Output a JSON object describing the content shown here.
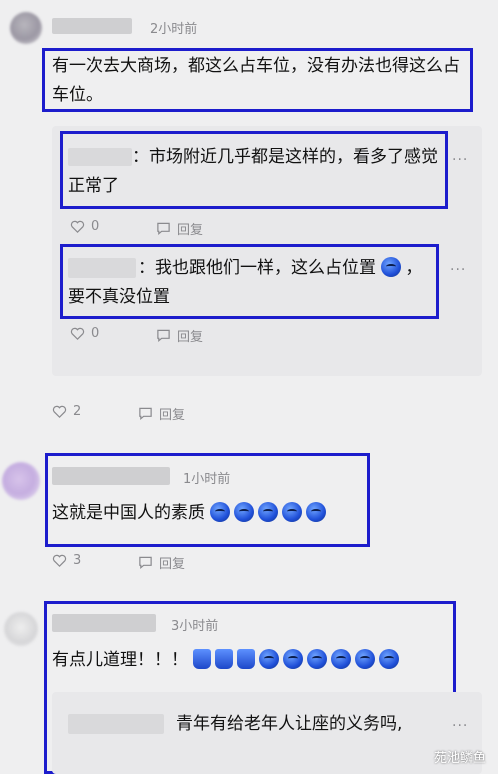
{
  "comments": [
    {
      "time": "2小时前",
      "text": "有一次去大商场，都这么占车位，没有办法也得这么占车位。",
      "replies": [
        {
          "separator": "：",
          "text": "市场附近几乎都是这样的，看多了感觉正常了",
          "likes": "0",
          "reply_label": "回复"
        },
        {
          "separator": "：",
          "text": "我也跟他们一样，这么占位置",
          "text_tail": "，要不真没位置",
          "likes": "0",
          "reply_label": "回复"
        }
      ],
      "likes": "2",
      "reply_label": "回复"
    },
    {
      "time": "1小时前",
      "text": "这就是中国人的素质",
      "likes": "3",
      "reply_label": "回复"
    },
    {
      "time": "3小时前",
      "text": "有点儿道理！！！",
      "replies": [
        {
          "text": "青年有给老年人让座的义务吗,"
        }
      ]
    }
  ],
  "more_label": "···",
  "icons": {
    "like": "heart-icon",
    "reply": "comment-icon",
    "emoji_blue": "blue-emoji-icon",
    "emoji_thumb": "thumbs-up-emoji-icon"
  },
  "highlight_color": "#1c1ccc",
  "watermark": "苑池鳞鱼"
}
